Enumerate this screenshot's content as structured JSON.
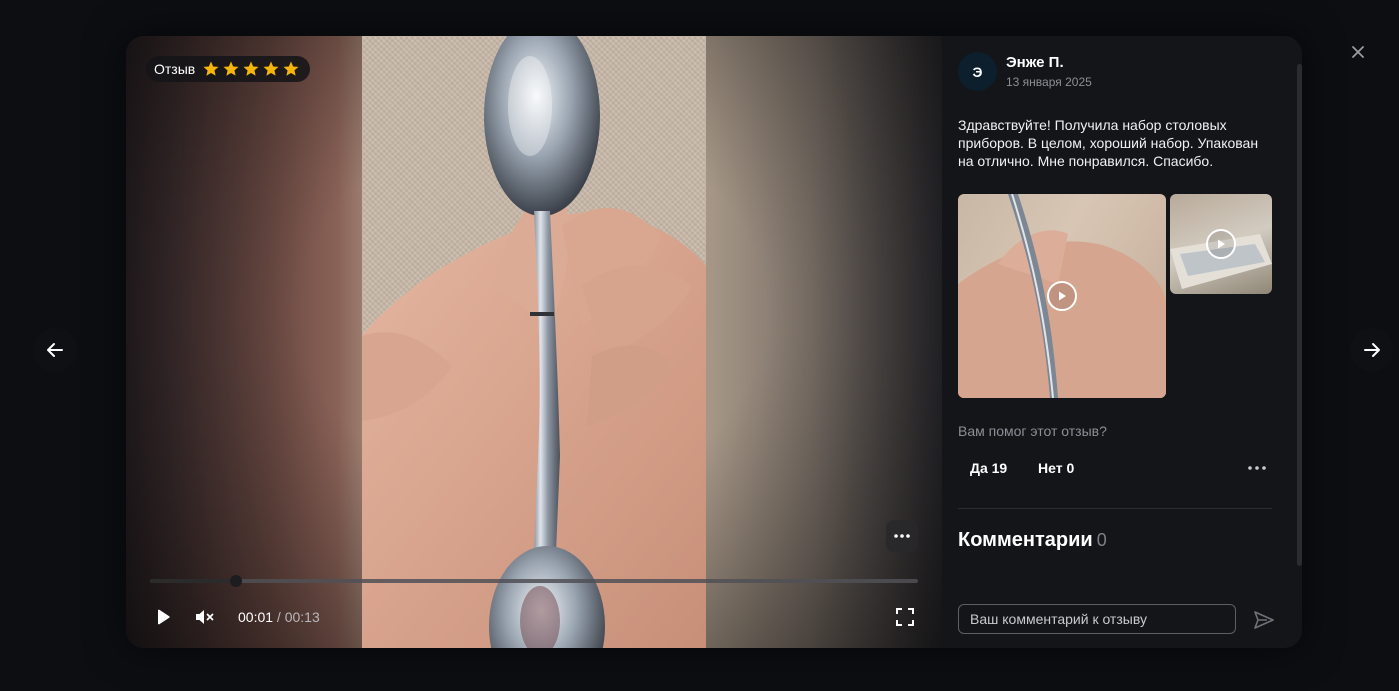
{
  "media": {
    "badge_label": "Отзыв",
    "rating": 5,
    "rating_max": 5,
    "star_color": "#f5b50a",
    "progress": 0.112,
    "time_current": "00:01",
    "time_separator": " / ",
    "time_total": "00:13",
    "icons": {
      "more": "more-horizontal-icon",
      "play": "play-icon",
      "mute": "volume-muted-icon",
      "fullscreen": "fullscreen-icon"
    }
  },
  "review": {
    "avatar_letter": "Э",
    "author": "Энже П.",
    "date": "13 января 2025",
    "text": "Здравствуйте! Получила набор столовых приборов. В целом, хороший набор. Упакован на отлично. Мне понравился. Спасибо.",
    "helpful_question": "Вам помог этот отзыв?",
    "yes_label": "Да 19",
    "no_label": "Нет 0"
  },
  "comments": {
    "title": "Комментарии",
    "count": "0",
    "input_placeholder": "Ваш комментарий к отзыву"
  },
  "colors": {
    "page_bg": "#0c0e12",
    "panel_bg": "#141519",
    "muted_text": "#8c8f96"
  }
}
